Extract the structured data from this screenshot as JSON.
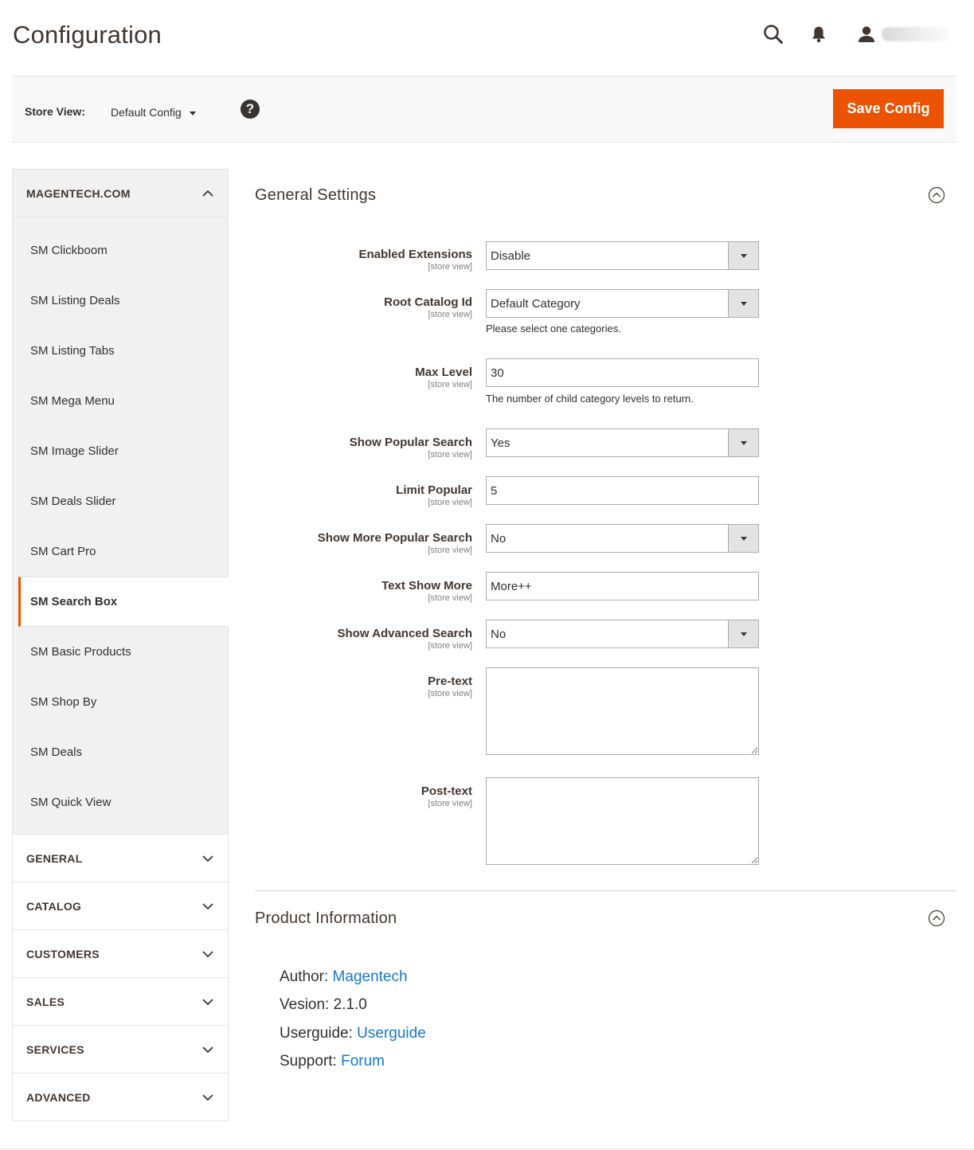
{
  "header": {
    "title": "Configuration",
    "icons": [
      "search-icon",
      "bell-icon",
      "user-icon"
    ]
  },
  "toolbar": {
    "store_view_label": "Store View:",
    "store_view_value": "Default Config",
    "save_label": "Save Config",
    "accent_color": "#eb5202"
  },
  "sidebar": {
    "top_group": "MAGENTECH.COM",
    "items": [
      "SM Clickboom",
      "SM Listing Deals",
      "SM Listing Tabs",
      "SM Mega Menu",
      "SM Image Slider",
      "SM Deals Slider",
      "SM Cart Pro",
      "SM Search Box",
      "SM Basic Products",
      "SM Shop By",
      "SM Deals",
      "SM Quick View"
    ],
    "active_item": "SM Search Box",
    "groups": [
      "GENERAL",
      "CATALOG",
      "CUSTOMERS",
      "SALES",
      "SERVICES",
      "ADVANCED"
    ]
  },
  "general": {
    "title": "General Settings",
    "scope": "[store view]",
    "fields": {
      "enabled": {
        "label": "Enabled Extensions",
        "value": "Disable"
      },
      "root": {
        "label": "Root Catalog Id",
        "value": "Default Category",
        "note": "Please select one categories."
      },
      "max_level": {
        "label": "Max Level",
        "value": "30",
        "note": "The number of child category levels to return."
      },
      "popular": {
        "label": "Show Popular Search",
        "value": "Yes"
      },
      "limit": {
        "label": "Limit Popular",
        "value": "5"
      },
      "more_popular": {
        "label": "Show More Popular Search",
        "value": "No"
      },
      "text_more": {
        "label": "Text Show More",
        "value": "More++"
      },
      "advanced": {
        "label": "Show Advanced Search",
        "value": "No"
      },
      "pre_text": {
        "label": "Pre-text",
        "value": ""
      },
      "post_text": {
        "label": "Post-text",
        "value": ""
      }
    }
  },
  "product_info": {
    "title": "Product Information",
    "author_label": "Author:",
    "author_link": "Magentech",
    "version_text": "Vesion: 2.1.0",
    "userguide_label": "Userguide:",
    "userguide_link": "Userguide",
    "support_label": "Support:",
    "support_link": "Forum"
  }
}
